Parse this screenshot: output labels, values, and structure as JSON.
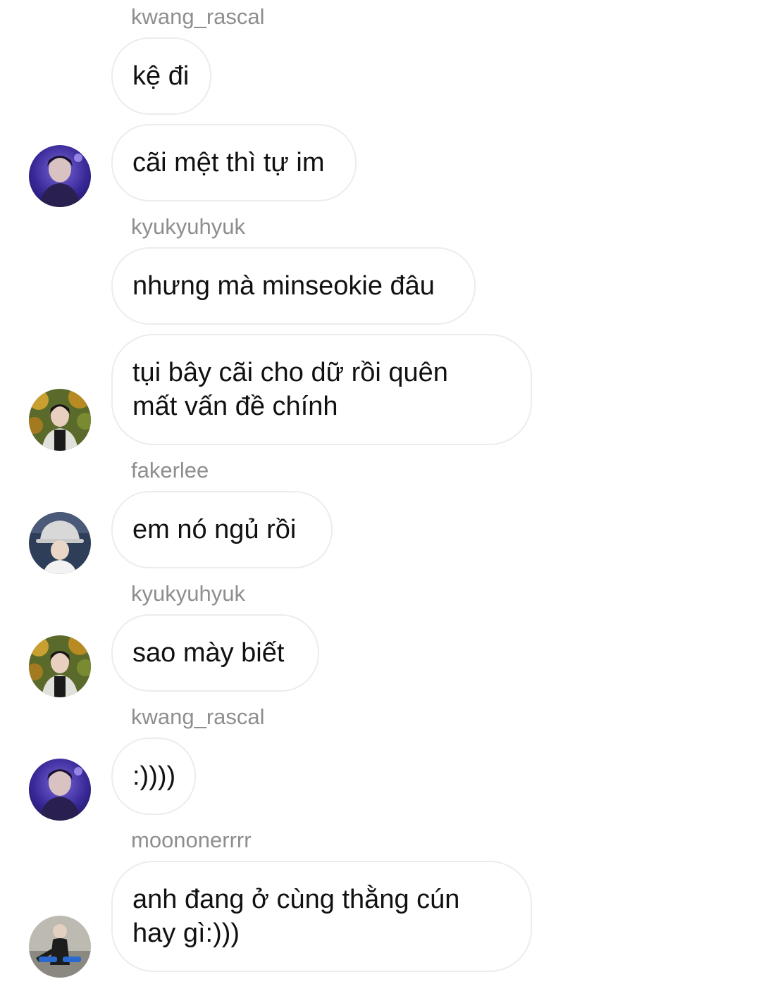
{
  "messages": [
    {
      "username": "kwang_rascal",
      "text": "kệ đi"
    },
    {
      "username": "",
      "text": "cãi mệt thì tự im"
    },
    {
      "username": "kyukyuhyuk",
      "text": "nhưng mà minseokie đâu"
    },
    {
      "username": "",
      "text": "tụi bây cãi cho dữ rồi quên mất vấn đề chính"
    },
    {
      "username": "fakerlee",
      "text": "em nó ngủ rồi"
    },
    {
      "username": "kyukyuhyuk",
      "text": "sao mày biết"
    },
    {
      "username": "kwang_rascal",
      "text": ":))))"
    },
    {
      "username": "moononerrrr",
      "text": "anh đang ở cùng thằng cún hay gì:)))"
    }
  ],
  "avatars": {
    "kwang_rascal": "avatar-purple-stage-photo",
    "kyukyuhyuk": "avatar-autumn-leaves-photo",
    "fakerlee": "avatar-bucket-hat-photo",
    "moononerrrr": "avatar-gym-photo"
  }
}
